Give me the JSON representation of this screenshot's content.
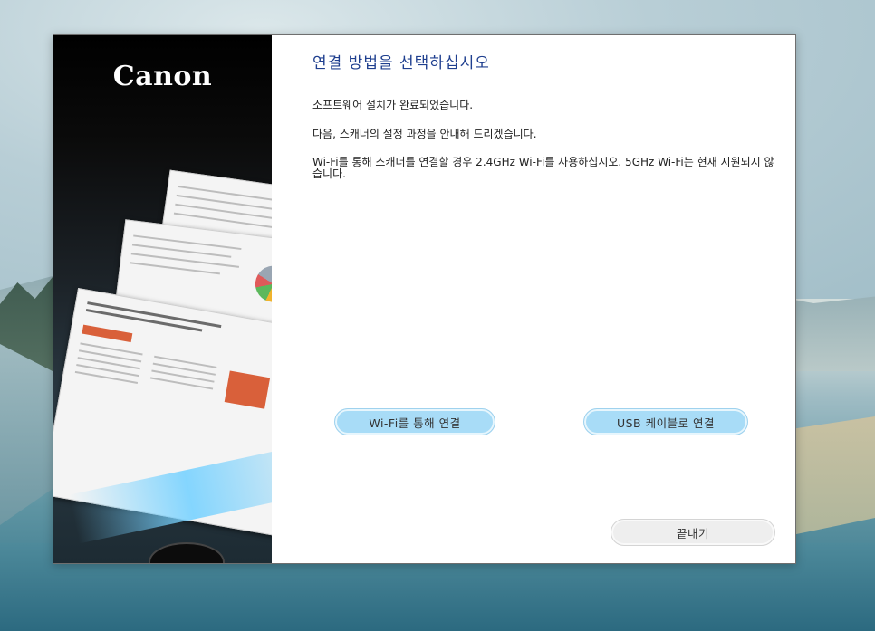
{
  "brand": {
    "logo_text": "Canon"
  },
  "dialog": {
    "title": "연결 방법을 선택하십시오",
    "paragraphs": [
      "소프트웨어 설치가 완료되었습니다.",
      "다음, 스캐너의 설정 과정을 안내해 드리겠습니다.",
      "Wi-Fi를 통해 스캐너를 연결할 경우 2.4GHz Wi-Fi를 사용하십시오. 5GHz Wi-Fi는 현재 지원되지 않습니다."
    ],
    "buttons": {
      "wifi": "Wi-Fi를 통해 연결",
      "usb": "USB 케이블로 연결",
      "exit": "끝내기"
    }
  },
  "colors": {
    "title": "#1f3f8f",
    "primary_button": "#a8dcf7",
    "secondary_button": "#eeeeee",
    "side_panel": "#000000"
  }
}
